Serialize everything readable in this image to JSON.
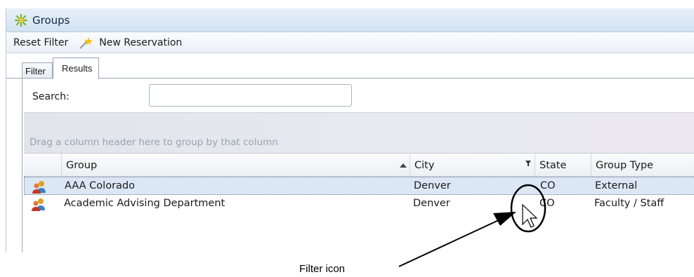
{
  "window": {
    "title": "Groups"
  },
  "toolbar": {
    "reset_filter": "Reset Filter",
    "new_reservation": "New Reservation"
  },
  "tabs": [
    {
      "label": "Filter"
    },
    {
      "label": "Results"
    }
  ],
  "search": {
    "label": "Search:",
    "value": ""
  },
  "grid": {
    "group_panel_hint": "Drag a column header here to group by that column",
    "columns": [
      {
        "label": "Group"
      },
      {
        "label": "City"
      },
      {
        "label": "State"
      },
      {
        "label": "Group Type"
      }
    ],
    "rows": [
      {
        "group": "AAA Colorado",
        "city": "Denver",
        "state": "CO",
        "type": "External"
      },
      {
        "group": "Academic Advising Department",
        "city": "Denver",
        "state": "CO",
        "type": "Faculty / Staff"
      }
    ]
  },
  "annotation": {
    "caption": "Filter icon"
  }
}
